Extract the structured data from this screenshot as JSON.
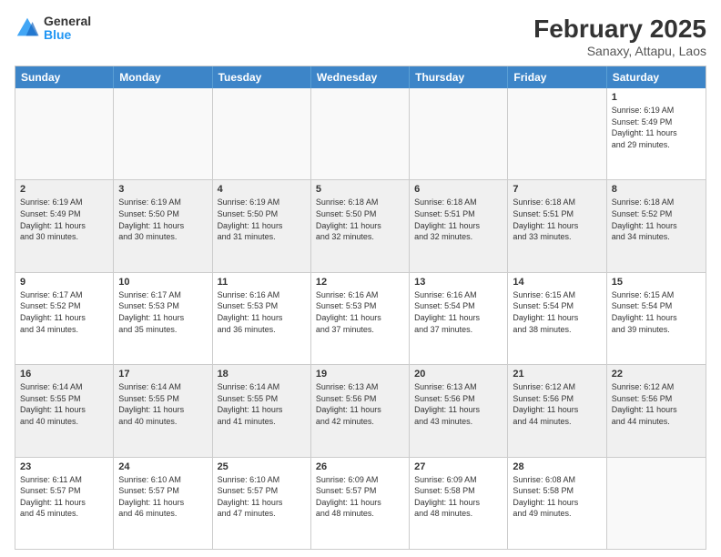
{
  "logo": {
    "general": "General",
    "blue": "Blue"
  },
  "title": {
    "month": "February 2025",
    "location": "Sanaxy, Attapu, Laos"
  },
  "header_days": [
    "Sunday",
    "Monday",
    "Tuesday",
    "Wednesday",
    "Thursday",
    "Friday",
    "Saturday"
  ],
  "weeks": [
    [
      {
        "day": "",
        "info": ""
      },
      {
        "day": "",
        "info": ""
      },
      {
        "day": "",
        "info": ""
      },
      {
        "day": "",
        "info": ""
      },
      {
        "day": "",
        "info": ""
      },
      {
        "day": "",
        "info": ""
      },
      {
        "day": "1",
        "info": "Sunrise: 6:19 AM\nSunset: 5:49 PM\nDaylight: 11 hours\nand 29 minutes."
      }
    ],
    [
      {
        "day": "2",
        "info": "Sunrise: 6:19 AM\nSunset: 5:49 PM\nDaylight: 11 hours\nand 30 minutes."
      },
      {
        "day": "3",
        "info": "Sunrise: 6:19 AM\nSunset: 5:50 PM\nDaylight: 11 hours\nand 30 minutes."
      },
      {
        "day": "4",
        "info": "Sunrise: 6:19 AM\nSunset: 5:50 PM\nDaylight: 11 hours\nand 31 minutes."
      },
      {
        "day": "5",
        "info": "Sunrise: 6:18 AM\nSunset: 5:50 PM\nDaylight: 11 hours\nand 32 minutes."
      },
      {
        "day": "6",
        "info": "Sunrise: 6:18 AM\nSunset: 5:51 PM\nDaylight: 11 hours\nand 32 minutes."
      },
      {
        "day": "7",
        "info": "Sunrise: 6:18 AM\nSunset: 5:51 PM\nDaylight: 11 hours\nand 33 minutes."
      },
      {
        "day": "8",
        "info": "Sunrise: 6:18 AM\nSunset: 5:52 PM\nDaylight: 11 hours\nand 34 minutes."
      }
    ],
    [
      {
        "day": "9",
        "info": "Sunrise: 6:17 AM\nSunset: 5:52 PM\nDaylight: 11 hours\nand 34 minutes."
      },
      {
        "day": "10",
        "info": "Sunrise: 6:17 AM\nSunset: 5:53 PM\nDaylight: 11 hours\nand 35 minutes."
      },
      {
        "day": "11",
        "info": "Sunrise: 6:16 AM\nSunset: 5:53 PM\nDaylight: 11 hours\nand 36 minutes."
      },
      {
        "day": "12",
        "info": "Sunrise: 6:16 AM\nSunset: 5:53 PM\nDaylight: 11 hours\nand 37 minutes."
      },
      {
        "day": "13",
        "info": "Sunrise: 6:16 AM\nSunset: 5:54 PM\nDaylight: 11 hours\nand 37 minutes."
      },
      {
        "day": "14",
        "info": "Sunrise: 6:15 AM\nSunset: 5:54 PM\nDaylight: 11 hours\nand 38 minutes."
      },
      {
        "day": "15",
        "info": "Sunrise: 6:15 AM\nSunset: 5:54 PM\nDaylight: 11 hours\nand 39 minutes."
      }
    ],
    [
      {
        "day": "16",
        "info": "Sunrise: 6:14 AM\nSunset: 5:55 PM\nDaylight: 11 hours\nand 40 minutes."
      },
      {
        "day": "17",
        "info": "Sunrise: 6:14 AM\nSunset: 5:55 PM\nDaylight: 11 hours\nand 40 minutes."
      },
      {
        "day": "18",
        "info": "Sunrise: 6:14 AM\nSunset: 5:55 PM\nDaylight: 11 hours\nand 41 minutes."
      },
      {
        "day": "19",
        "info": "Sunrise: 6:13 AM\nSunset: 5:56 PM\nDaylight: 11 hours\nand 42 minutes."
      },
      {
        "day": "20",
        "info": "Sunrise: 6:13 AM\nSunset: 5:56 PM\nDaylight: 11 hours\nand 43 minutes."
      },
      {
        "day": "21",
        "info": "Sunrise: 6:12 AM\nSunset: 5:56 PM\nDaylight: 11 hours\nand 44 minutes."
      },
      {
        "day": "22",
        "info": "Sunrise: 6:12 AM\nSunset: 5:56 PM\nDaylight: 11 hours\nand 44 minutes."
      }
    ],
    [
      {
        "day": "23",
        "info": "Sunrise: 6:11 AM\nSunset: 5:57 PM\nDaylight: 11 hours\nand 45 minutes."
      },
      {
        "day": "24",
        "info": "Sunrise: 6:10 AM\nSunset: 5:57 PM\nDaylight: 11 hours\nand 46 minutes."
      },
      {
        "day": "25",
        "info": "Sunrise: 6:10 AM\nSunset: 5:57 PM\nDaylight: 11 hours\nand 47 minutes."
      },
      {
        "day": "26",
        "info": "Sunrise: 6:09 AM\nSunset: 5:57 PM\nDaylight: 11 hours\nand 48 minutes."
      },
      {
        "day": "27",
        "info": "Sunrise: 6:09 AM\nSunset: 5:58 PM\nDaylight: 11 hours\nand 48 minutes."
      },
      {
        "day": "28",
        "info": "Sunrise: 6:08 AM\nSunset: 5:58 PM\nDaylight: 11 hours\nand 49 minutes."
      },
      {
        "day": "",
        "info": ""
      }
    ]
  ]
}
